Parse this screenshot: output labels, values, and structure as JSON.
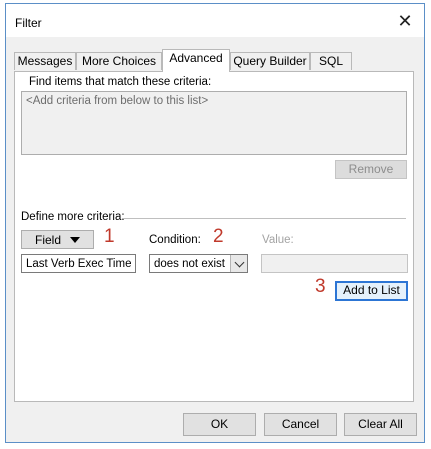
{
  "window": {
    "title": "Filter",
    "close_glyph": "✕"
  },
  "tabs": [
    {
      "label": "Messages"
    },
    {
      "label": "More Choices"
    },
    {
      "label": "Advanced",
      "active": true
    },
    {
      "label": "Query Builder"
    },
    {
      "label": "SQL"
    }
  ],
  "advanced": {
    "find_label": "Find items that match these criteria:",
    "criteria_placeholder": "<Add criteria from below to this list>",
    "remove_label": "Remove",
    "define_label": "Define more criteria:",
    "field_label": "Field",
    "condition_label": "Condition:",
    "value_label": "Value:",
    "field_value": "Last Verb Exec Time",
    "condition_value": "does not exist",
    "add_label": "Add to List",
    "markers": [
      "1",
      "2",
      "3"
    ]
  },
  "footer": {
    "ok_label": "OK",
    "cancel_label": "Cancel",
    "clear_label": "Clear All"
  },
  "colors": {
    "marker": "#c0392b",
    "focus_border": "#2c75d4",
    "window_border": "#5b8fc7"
  }
}
